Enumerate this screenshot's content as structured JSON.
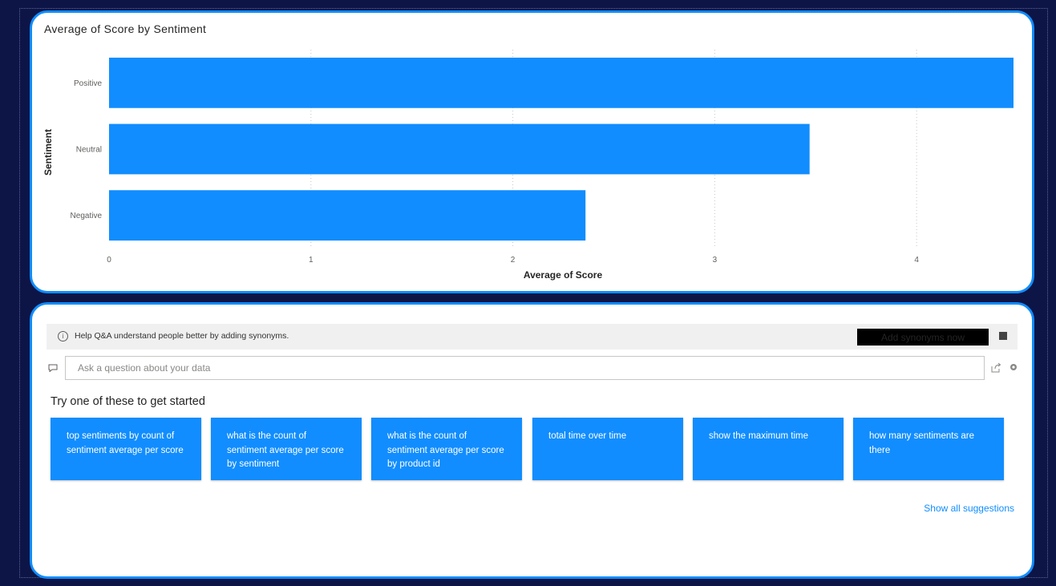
{
  "chart_card": {
    "title": "Average of Score by Sentiment"
  },
  "chart_data": {
    "type": "bar",
    "orientation": "horizontal",
    "title": "Average of Score by Sentiment",
    "xlabel": "Average of Score",
    "ylabel": "Sentiment",
    "categories": [
      "Positive",
      "Neutral",
      "Negative"
    ],
    "values": [
      4.48,
      3.47,
      2.36
    ],
    "xlim": [
      0,
      4.48
    ],
    "xticks": [
      0,
      1,
      2,
      3,
      4
    ],
    "grid": true,
    "bar_color": "#118dff"
  },
  "qa": {
    "banner_text": "Help Q&A understand people better by adding synonyms.",
    "add_synonyms_label": "Add synonyms now",
    "input_placeholder": "Ask a question about your data",
    "input_value": "",
    "try_heading": "Try one of these to get started",
    "suggestions": [
      "top sentiments by count of sentiment average per score",
      "what is the count of sentiment average per score by sentiment",
      "what is the count of sentiment average per score by product id",
      "total time over time",
      "show the maximum time",
      "how many sentiments are there"
    ],
    "show_all_label": "Show all suggestions"
  },
  "colors": {
    "background": "#0d1547",
    "accent": "#118dff",
    "card": "#ffffff"
  },
  "icons": {
    "info": "info-icon",
    "chat": "chat-icon",
    "share": "share-icon",
    "settings": "gear-icon",
    "dismiss": "close-icon"
  }
}
